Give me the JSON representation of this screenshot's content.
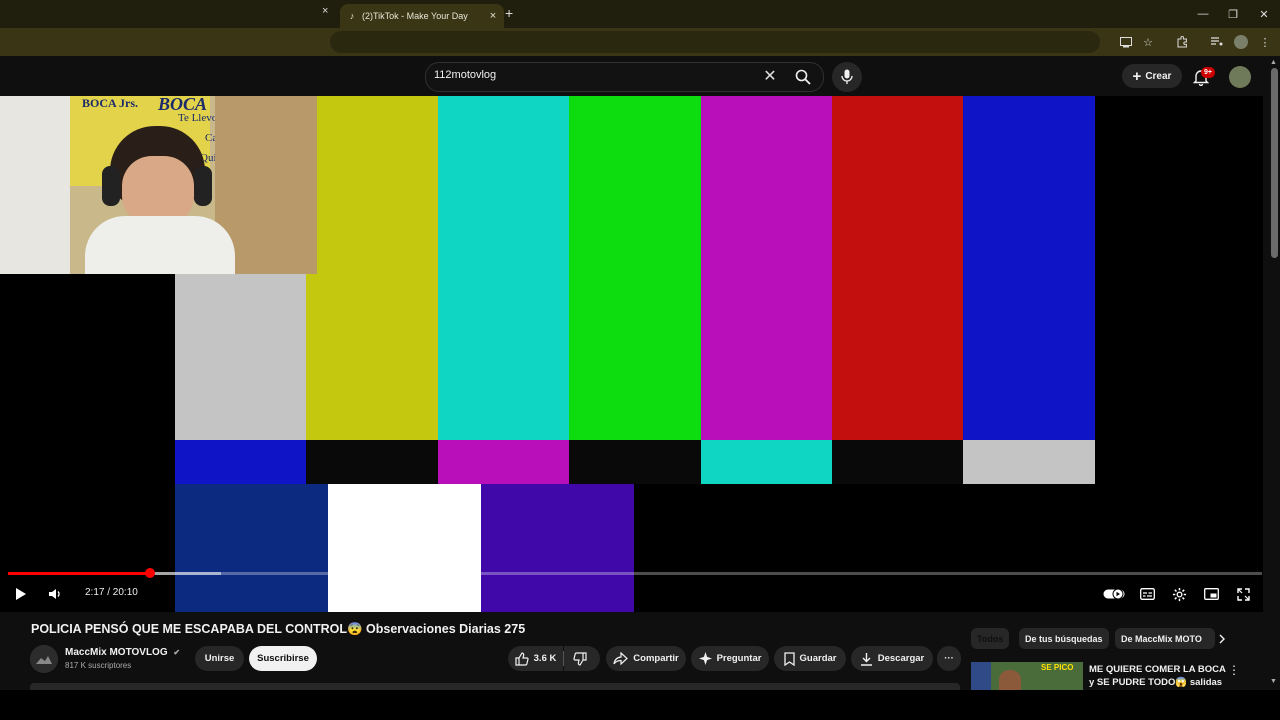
{
  "browser": {
    "tab": {
      "title": "(2)TikTok - Make Your Day",
      "close": "×"
    },
    "new_tab": "+",
    "window": {
      "minimize": "—",
      "restore": "❐",
      "close": "✕"
    },
    "win_close_left": "×"
  },
  "youtube": {
    "search": {
      "value": "112motovlog",
      "clear": "✕"
    },
    "create_label": "Crear",
    "notif_badge": "9+"
  },
  "player": {
    "time_label": "2:17 / 20:10",
    "progress": 0.113,
    "buffered": 0.17,
    "test_pattern": {
      "top_bars": [
        "#c4c4c4",
        "#c4c90f",
        "#0fd5c3",
        "#0ddd0f",
        "#b80fba",
        "#c40f0f",
        "#0f14c6"
      ],
      "mid_bars": [
        "#0f14c6",
        "#090909",
        "#b80fba",
        "#090909",
        "#0fd5c3",
        "#090909",
        "#c4c4c4"
      ],
      "bottom_bars": [
        "#0c2a80",
        "#ffffff",
        "#4008a8",
        "#000000"
      ]
    }
  },
  "video": {
    "title": "POLICIA PENSÓ QUE ME ESCAPABA DEL CONTROL😨 Observaciones Diarias 275",
    "channel": "MaccMix MOTOVLOG",
    "verified": "✔",
    "subscribers": "817 K suscriptores",
    "join_label": "Unirse",
    "subscribe_label": "Suscribirse",
    "likes": "3.6 K",
    "share_label": "Compartir",
    "ask_label": "Preguntar",
    "save_label": "Guardar",
    "download_label": "Descargar",
    "more": "···"
  },
  "chips": [
    {
      "label": "Todos"
    },
    {
      "label": "De tus búsquedas"
    },
    {
      "label": "De MaccMix MOTO"
    }
  ],
  "related": {
    "title": "ME QUIERE COMER LA BOCA y SE PUDRE TODO😱 salidas de...",
    "thumb_text": "SE PICO"
  },
  "webcam_sign": {
    "line1": "BOCA Jrs.",
    "line2": "BOCA",
    "line3": "Te Llevo en El Alma",
    "line4": "Cada Dia",
    "line5": "Quiero Mas"
  }
}
